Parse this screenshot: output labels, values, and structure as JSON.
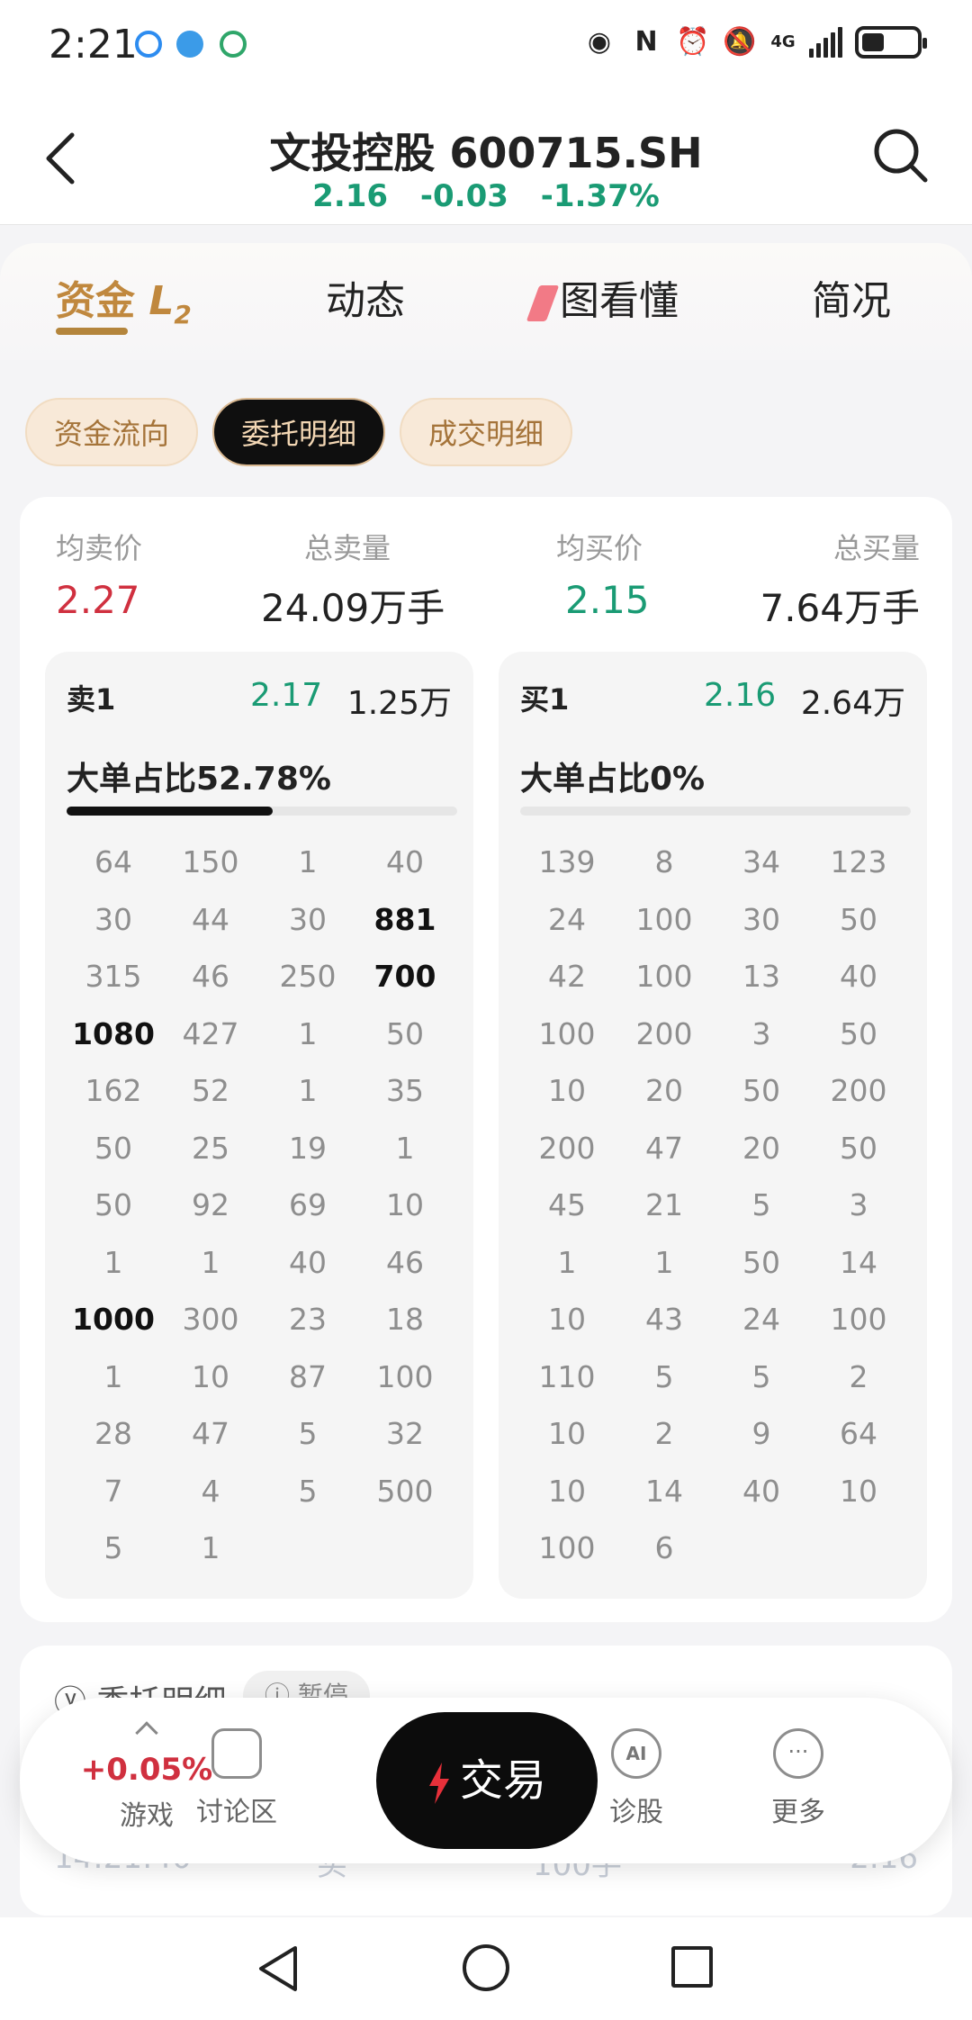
{
  "status": {
    "time": "2:21",
    "network": "4G"
  },
  "header": {
    "title": "文投控股 600715.SH",
    "price": "2.16",
    "change": "-0.03",
    "change_pct": "-1.37%"
  },
  "tabs": [
    {
      "label": "资金",
      "badge": "L",
      "badge_sub": "2"
    },
    {
      "label": "动态"
    },
    {
      "label": "图看懂"
    },
    {
      "label": "简况"
    }
  ],
  "chips": [
    "资金流向",
    "委托明细",
    "成交明细"
  ],
  "summary": {
    "avg_sell_label": "均卖价",
    "avg_sell": "2.27",
    "total_sell_label": "总卖量",
    "total_sell": "24.09万手",
    "avg_buy_label": "均买价",
    "avg_buy": "2.15",
    "total_buy_label": "总买量",
    "total_buy": "7.64万手"
  },
  "sell_book": {
    "label": "卖1",
    "price": "2.17",
    "volume": "1.25万",
    "ratio_text": "大单占比52.78%",
    "ratio": 0.5278,
    "orders": [
      "64",
      "150",
      "1",
      "40",
      "30",
      "44",
      "30",
      "881",
      "315",
      "46",
      "250",
      "700",
      "1080",
      "427",
      "1",
      "50",
      "162",
      "52",
      "1",
      "35",
      "50",
      "25",
      "19",
      "1",
      "50",
      "92",
      "69",
      "10",
      "1",
      "1",
      "40",
      "46",
      "1000",
      "300",
      "23",
      "18",
      "1",
      "10",
      "87",
      "100",
      "28",
      "47",
      "5",
      "32",
      "7",
      "4",
      "5",
      "500",
      "5",
      "1"
    ],
    "big_orders": [
      "881",
      "700",
      "1080",
      "1000"
    ]
  },
  "buy_book": {
    "label": "买1",
    "price": "2.16",
    "volume": "2.64万",
    "ratio_text": "大单占比0%",
    "ratio": 0,
    "orders": [
      "139",
      "8",
      "34",
      "123",
      "24",
      "100",
      "30",
      "50",
      "42",
      "100",
      "13",
      "40",
      "100",
      "200",
      "3",
      "50",
      "10",
      "20",
      "50",
      "200",
      "200",
      "47",
      "20",
      "50",
      "45",
      "21",
      "5",
      "3",
      "1",
      "1",
      "50",
      "14",
      "10",
      "43",
      "24",
      "100",
      "110",
      "5",
      "5",
      "2",
      "10",
      "2",
      "9",
      "64",
      "10",
      "14",
      "40",
      "10",
      "100",
      "6"
    ]
  },
  "lower_card": {
    "title": "委托明细",
    "pill": "暂停",
    "ghost_time": "14:21:40",
    "ghost_side": "买",
    "ghost_vol": "100手",
    "ghost_price": "2.16"
  },
  "bottom_nav": {
    "game_change": "+0.05%",
    "game_label": "游戏",
    "discuss_label": "讨论区",
    "trade_label": "交易",
    "diagnose_label": "诊股",
    "more_label": "更多"
  },
  "colors": {
    "up_red": "#d0303f",
    "down_green": "#1a9b74",
    "gold": "#c0883e"
  }
}
